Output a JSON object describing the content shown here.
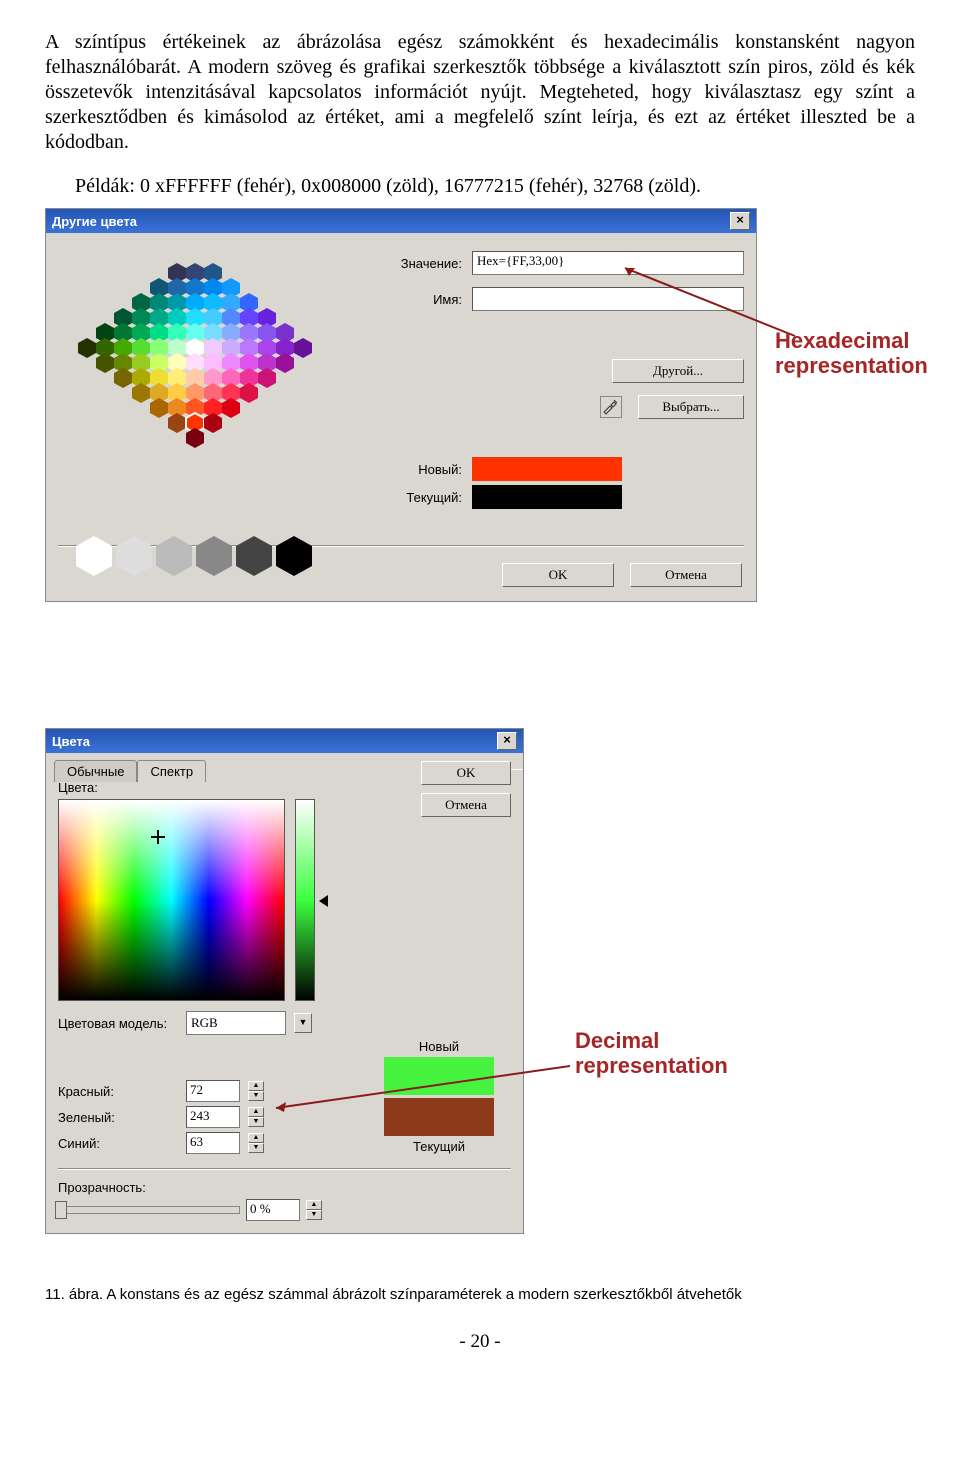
{
  "para1": "A színtípus értékeinek az ábrázolása egész számokként és hexadecimális konstansként nagyon felhasználóbarát. A modern szöveg és grafikai szerkesztők többsége a kiválasztott szín piros, zöld és kék összetevők intenzitásával kapcsolatos információt nyújt. Megteheted, hogy kiválasztasz egy színt a szerkesztődben és kimásolod az értéket, ami a megfelelő színt leírja, és ezt az értéket illeszted be a kódodban.",
  "examples": "Példák: 0 xFFFFFF (fehér), 0x008000 (zöld), 16777215 (fehér), 32768 (zöld).",
  "dlg1": {
    "title": "Другие цвета",
    "close": "×",
    "value_label": "Значение:",
    "value_text": "Hex={FF,33,00}",
    "name_label": "Имя:",
    "other_btn": "Другой...",
    "pick_btn": "Выбрать...",
    "new_label": "Новый:",
    "cur_label": "Текущий:",
    "ok": "OK",
    "cancel": "Отмена"
  },
  "annot_hex": "Hexadecimal representation",
  "dlg2": {
    "title": "Цвета",
    "tab1": "Обычные",
    "tab2": "Спектр",
    "ok": "OK",
    "cancel": "Отмена",
    "colors_label": "Цвета:",
    "model_label": "Цветовая модель:",
    "model_value": "RGB",
    "red_label": "Красный:",
    "red_value": "72",
    "green_label": "Зеленый:",
    "green_value": "243",
    "blue_label": "Синий:",
    "blue_value": "63",
    "new_label": "Новый",
    "cur_label": "Текущий",
    "trans_label": "Прозрачность:",
    "trans_value": "0 %"
  },
  "annot_dec": "Decimal representation",
  "figcap": "11. ábra. A konstans és az egész számmal ábrázolt színparaméterek a modern szerkesztőkből átvehetők",
  "pgnum": "- 20 -"
}
